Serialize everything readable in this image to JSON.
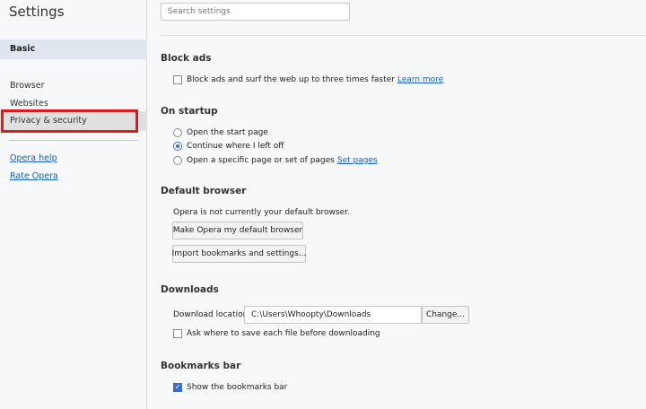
{
  "sidebar": {
    "title": "Settings",
    "basic": "Basic",
    "items": [
      "Browser",
      "Websites",
      "Privacy & security"
    ],
    "links": [
      "Opera help",
      "Rate Opera"
    ]
  },
  "search": {
    "placeholder": "Search settings"
  },
  "block_ads": {
    "title": "Block ads",
    "checkbox_label": "Block ads and surf the web up to three times faster",
    "learn_more": "Learn more",
    "checked": false
  },
  "startup": {
    "title": "On startup",
    "options": [
      "Open the start page",
      "Continue where I left off",
      "Open a specific page or set of pages"
    ],
    "selected": 1,
    "set_pages": "Set pages"
  },
  "default_browser": {
    "title": "Default browser",
    "status": "Opera is not currently your default browser.",
    "make_default": "Make Opera my default browser",
    "import": "Import bookmarks and settings..."
  },
  "downloads": {
    "title": "Downloads",
    "location_label": "Download location:",
    "location_value": "C:\\Users\\Whoopty\\Downloads",
    "change": "Change...",
    "ask_label": "Ask where to save each file before downloading",
    "ask_checked": false
  },
  "bookmarks_bar": {
    "title": "Bookmarks bar",
    "show_label": "Show the bookmarks bar",
    "show_checked": true
  },
  "colors": {
    "accent": "#3c6fc8",
    "link": "#1a5fb4",
    "highlight": "#d62020"
  }
}
